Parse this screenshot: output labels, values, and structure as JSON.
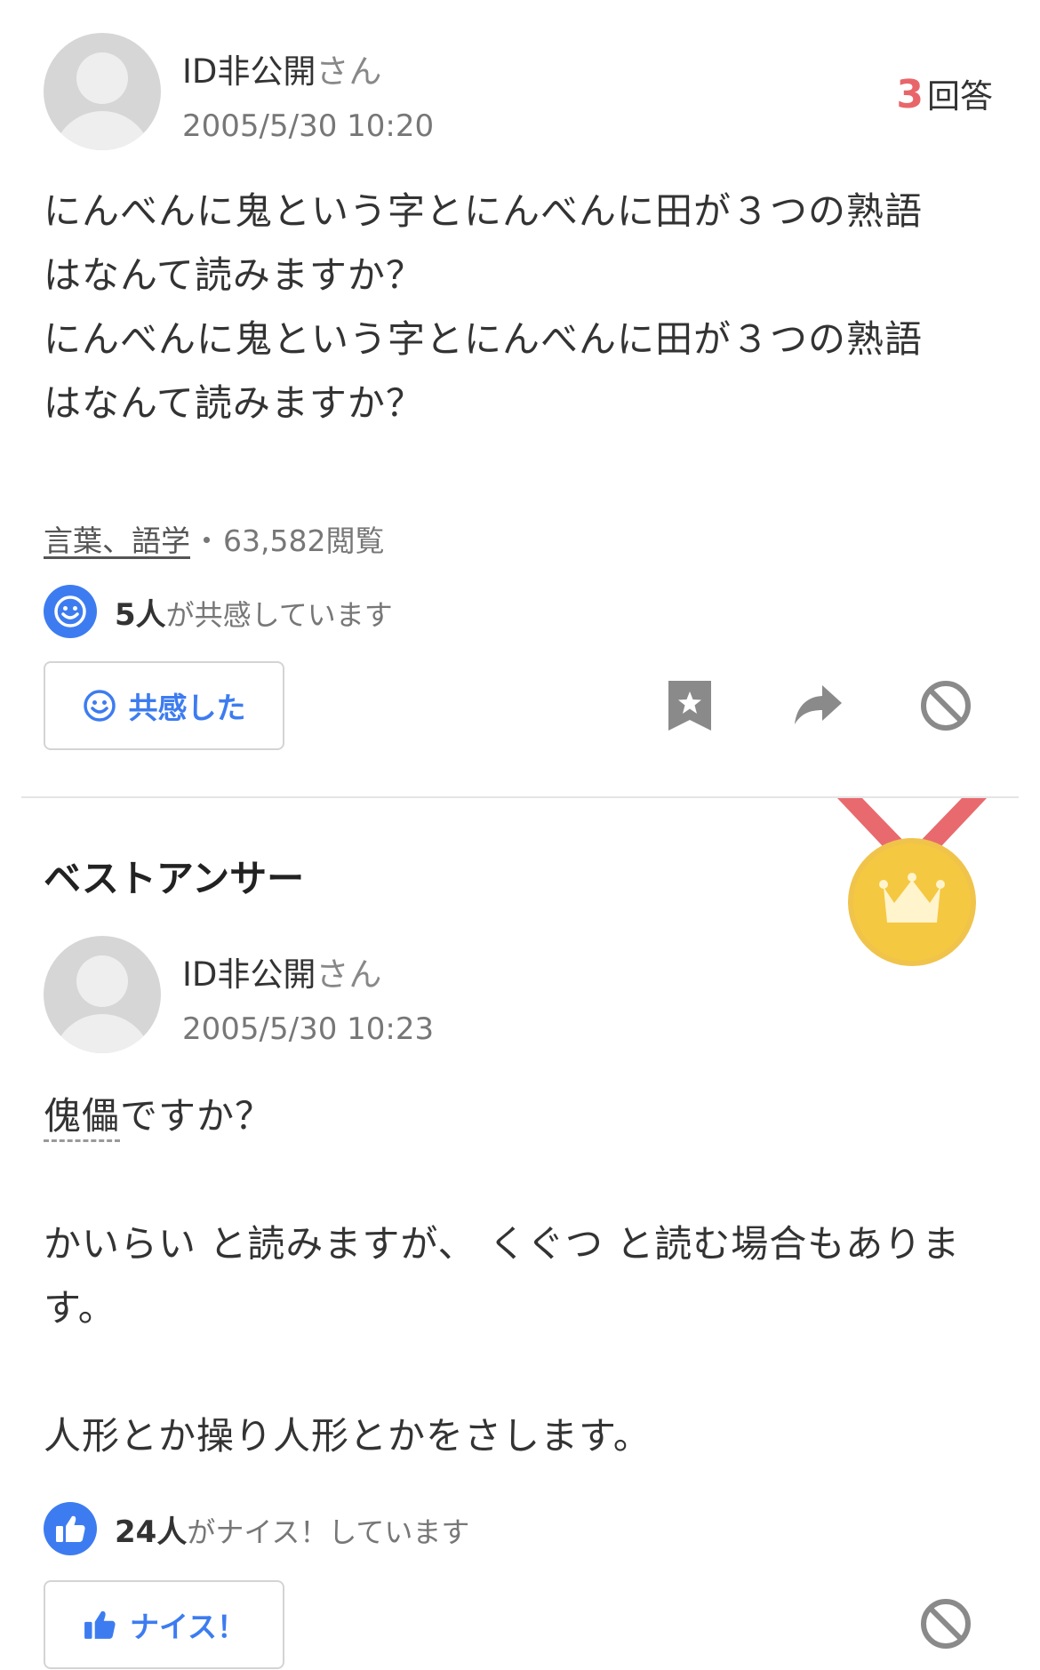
{
  "question": {
    "user_name": "ID非公開",
    "user_suffix": "さん",
    "date": "2005/5/30 10:20",
    "answer_count": "3",
    "answer_count_label": "回答",
    "body_lines": [
      "にんべんに鬼という字とにんべんに田が３つの熟語",
      "はなんて読みますか？",
      "にんべんに鬼という字とにんべんに田が３つの熟語",
      "はなんて読みますか？"
    ],
    "category": "言葉、語学",
    "separator": "・",
    "views": "63,582閲覧",
    "empathy_count": "5人",
    "empathy_suffix": "が共感しています",
    "empathy_button": "共感した"
  },
  "best_answer": {
    "section_title": "ベストアンサー",
    "user_name": "ID非公開",
    "user_suffix": "さん",
    "date": "2005/5/30 10:23",
    "answer_word": "傀儡",
    "answer_word_suffix": "ですか？",
    "line2": "かいらい と読みますが、 くぐつ と読む場合もありま",
    "line3": "す。",
    "line4": "人形とか操り人形とかをさします。",
    "nice_count": "24人",
    "nice_suffix": "がナイス！しています",
    "nice_button": "ナイス！"
  },
  "colors": {
    "accent_blue": "#3d7cf0",
    "answer_count_red": "#e8666a",
    "medal_gold": "#f5c842",
    "ribbon_red": "#e86a6e"
  },
  "icons": [
    "smile-icon",
    "bookmark-star-icon",
    "share-arrow-icon",
    "block-icon",
    "thumbs-up-icon",
    "medal-crown-icon"
  ]
}
